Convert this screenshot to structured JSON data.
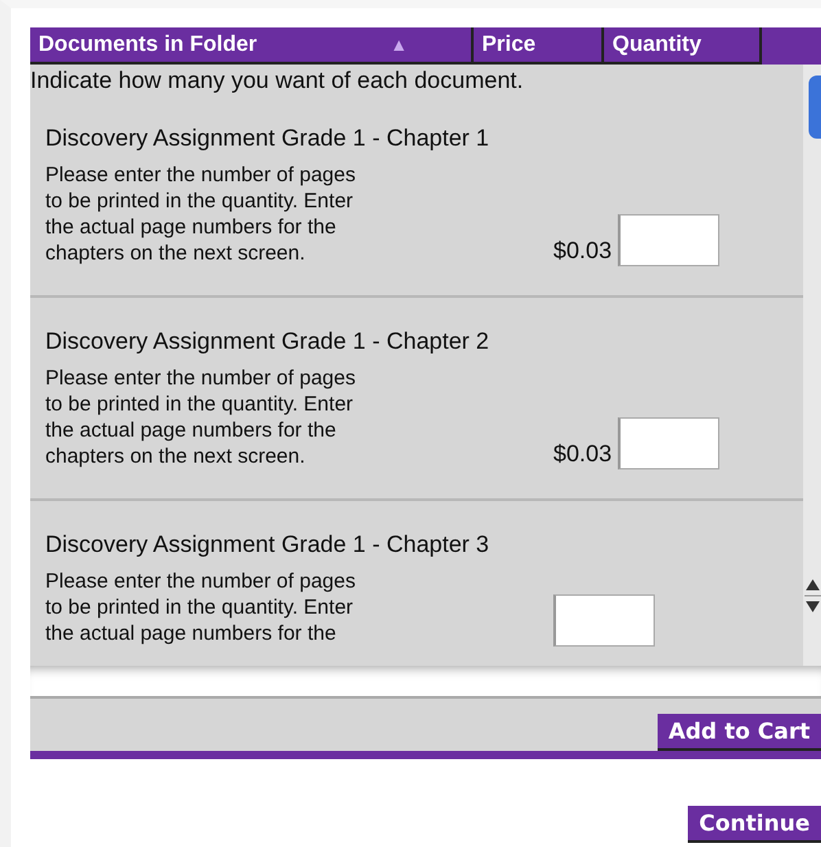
{
  "columns": [
    {
      "label": "Documents in Folder",
      "sort_icon": "▲"
    },
    {
      "label": "Price"
    },
    {
      "label": "Quantity"
    }
  ],
  "instruction": "Indicate how many you want of each document.",
  "documents": [
    {
      "title": "Discovery Assignment Grade 1 - Chapter 1",
      "description": [
        "Please enter the number of pages",
        "to be printed in the quantity. Enter",
        "the actual page numbers for the",
        "chapters on the next screen."
      ],
      "price": "$0.03"
    },
    {
      "title": "Discovery Assignment Grade 1 - Chapter 2",
      "description": [
        "Please enter the number of pages",
        "to be printed in the quantity. Enter",
        "the actual page numbers for the",
        "chapters on the next screen."
      ],
      "price": "$0.03"
    },
    {
      "title": "Discovery Assignment Grade 1 - Chapter 3",
      "description": [
        "Please enter the number of pages",
        "to be printed in the quantity. Enter",
        "the actual page numbers for the"
      ]
    }
  ],
  "add_button": "Add to Cart",
  "continue_button": "Continue"
}
